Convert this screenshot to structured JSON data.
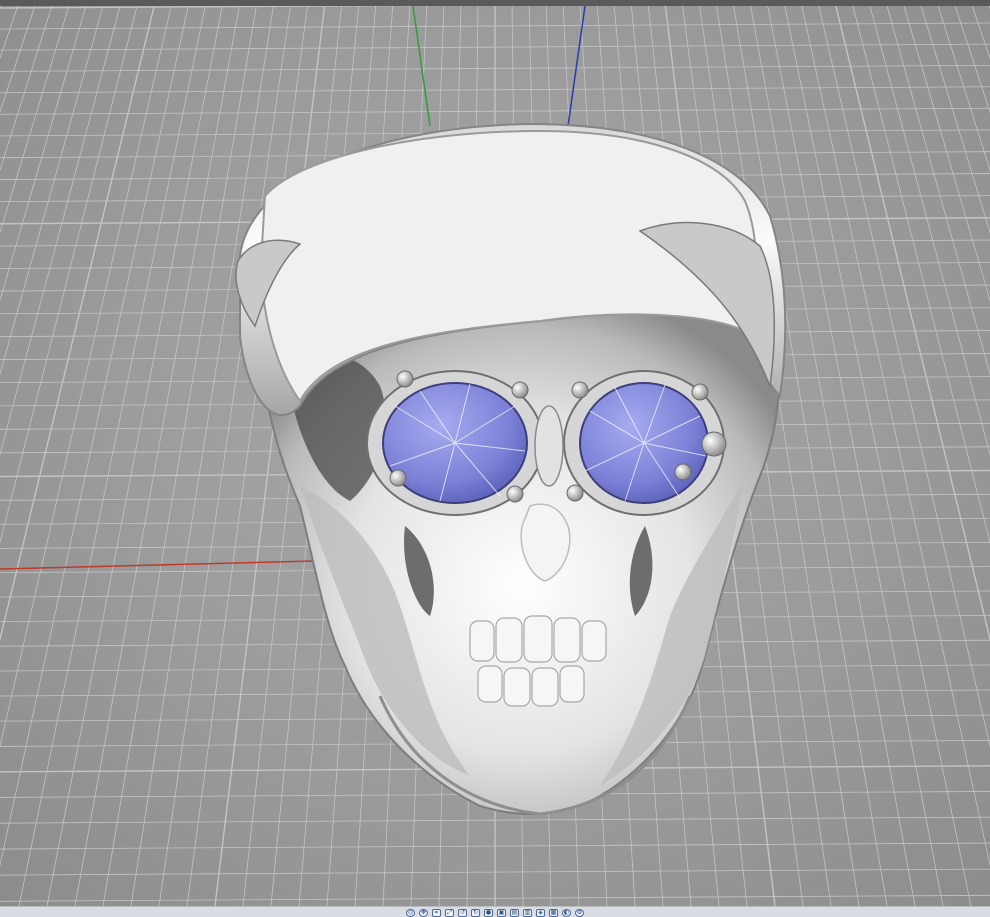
{
  "viewport": {
    "background_color": "#9b9b9b",
    "grid_color": "#c4c4c4",
    "axes": {
      "x_axis_color": "#c0392b",
      "y_axis_color": "#2e9e3a",
      "z_axis_color": "#2b3bb0"
    },
    "model": {
      "object": "skull-with-goggles",
      "skull_color": "#e6e6e6",
      "lens_color": "#7b80d6"
    }
  },
  "toolbar": {
    "buttons": [
      {
        "name": "orbit-icon",
        "glyph": "◎"
      },
      {
        "name": "pan-icon",
        "glyph": "✥"
      },
      {
        "name": "zoom-window-icon",
        "glyph": "⌗"
      },
      {
        "name": "zoom-extents-icon",
        "glyph": "⤢"
      },
      {
        "name": "rotate-left-icon",
        "glyph": "↺"
      },
      {
        "name": "rotate-right-icon",
        "glyph": "↻"
      },
      {
        "name": "shaded-view-icon",
        "glyph": "●"
      },
      {
        "name": "front-view-icon",
        "glyph": "▣"
      },
      {
        "name": "top-view-icon",
        "glyph": "▤"
      },
      {
        "name": "side-view-icon",
        "glyph": "▥"
      },
      {
        "name": "perspective-icon",
        "glyph": "◈"
      },
      {
        "name": "wireframe-icon",
        "glyph": "▦"
      },
      {
        "name": "light-icon",
        "glyph": "◐"
      },
      {
        "name": "settings-icon",
        "glyph": "⚙"
      }
    ]
  }
}
